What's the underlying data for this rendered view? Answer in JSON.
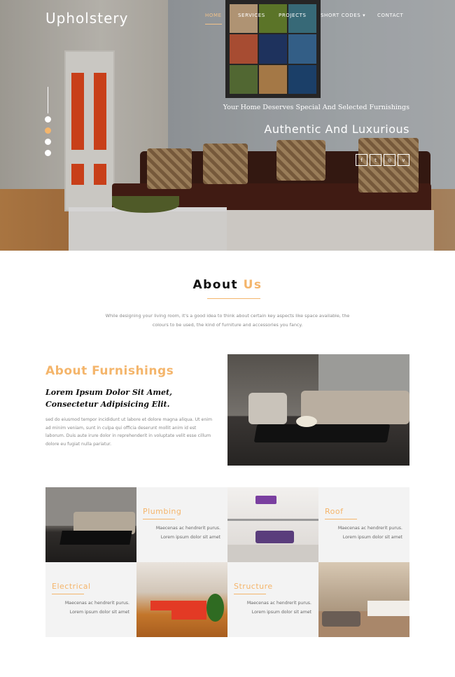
{
  "brand": {
    "logo": "Upholstery"
  },
  "nav": [
    {
      "label": "Home",
      "active": true
    },
    {
      "label": "Services",
      "active": false
    },
    {
      "label": "Projects",
      "active": false
    },
    {
      "label": "Short Codes ▾",
      "active": false
    },
    {
      "label": "Contact",
      "active": false
    }
  ],
  "hero": {
    "subtitle": "Your Home Deserves Special And Selected Furnishings",
    "title": "Authentic And Luxurious",
    "socials": [
      "f",
      "t",
      "◎",
      "v"
    ],
    "slide_count": 4,
    "active_slide": 1
  },
  "about": {
    "title_main": "About",
    "title_accent": "Us",
    "text": "While designing your living room, it's a good idea to think about certain key aspects like space available, the colours to be used, the kind of furniture and accessories you fancy."
  },
  "furnishings": {
    "title": "About Furnishings",
    "subtitle": "Lorem Ipsum Dolor Sit Amet, Consectetur Adipisicing Elit.",
    "text": "sed do eiusmod tempor incididunt ut labore et dolore magna aliqua. Ut enim ad minim veniam, sunt in culpa qui officia deserunt mollit anim id est laborum. Duis aute irure dolor in reprehenderit in voluptate velit esse cillum dolore eu fugiat nulla pariatur."
  },
  "services": [
    {
      "title": "Plumbing",
      "line1": "Maecenas ac hendrerit purus.",
      "line2": "Lorem ipsum dolor sit amet"
    },
    {
      "title": "Roof",
      "line1": "Maecenas ac hendrerit purus.",
      "line2": "Lorem ipsum dolor sit amet"
    },
    {
      "title": "Electrical",
      "line1": "Maecenas ac hendrerit purus.",
      "line2": "Lorem ipsum dolor sit amet"
    },
    {
      "title": "Structure",
      "line1": "Maecenas ac hendrerit purus.",
      "line2": "Lorem ipsum dolor sit amet"
    }
  ],
  "colors": {
    "accent": "#f4b56b",
    "text_dark": "#111111",
    "text_muted": "#888888"
  }
}
